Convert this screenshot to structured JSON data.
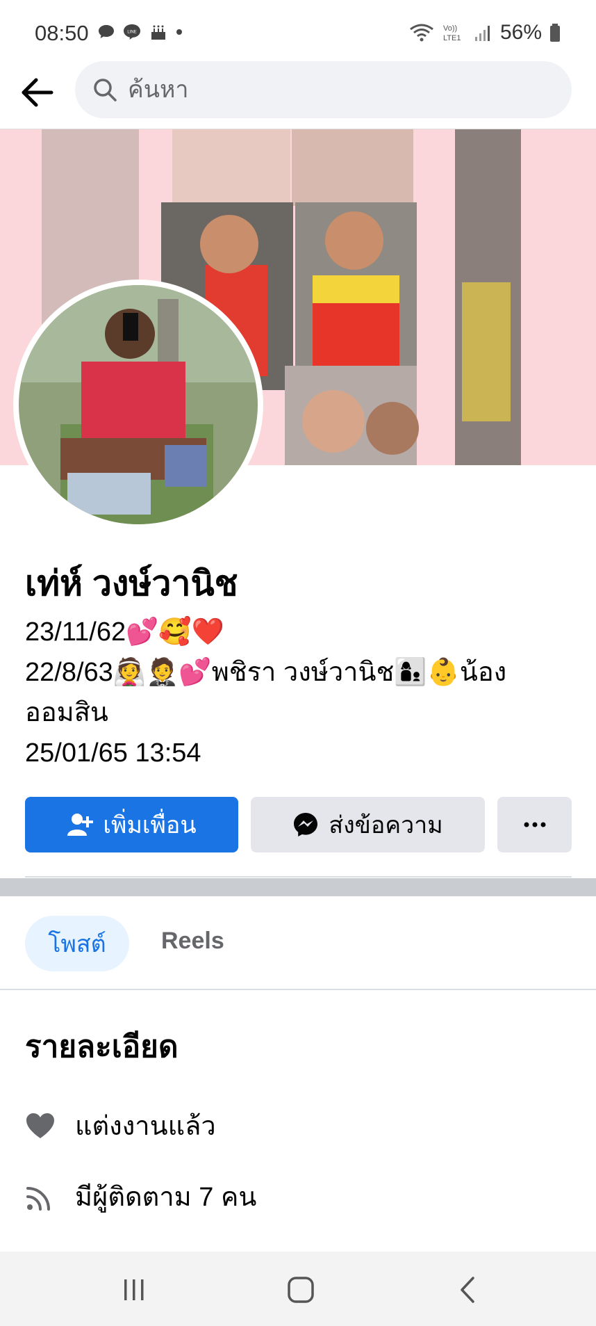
{
  "status": {
    "time": "08:50",
    "battery": "56%",
    "network": "LTE1"
  },
  "search": {
    "placeholder": "ค้นหา"
  },
  "profile": {
    "name": "เท่ห์ วงษ์วานิช",
    "bio_lines": [
      "23/11/62💕🥰❤️",
      "22/8/63👰🤵💕พชิรา วงษ์วานิช👩‍👦👶น้อง",
      "ออมสิน",
      "25/01/65 13:54"
    ]
  },
  "actions": {
    "add_friend": "เพิ่มเพื่อน",
    "message": "ส่งข้อความ"
  },
  "tabs": {
    "posts": "โพสต์",
    "reels": "Reels"
  },
  "details": {
    "title": "รายละเอียด",
    "relationship": "แต่งงานแล้ว",
    "followers": "มีผู้ติดตาม 7 คน"
  },
  "colors": {
    "primary": "#1b74e4",
    "button_gray": "#e4e6eb",
    "cover_bg": "#fbd6da"
  }
}
